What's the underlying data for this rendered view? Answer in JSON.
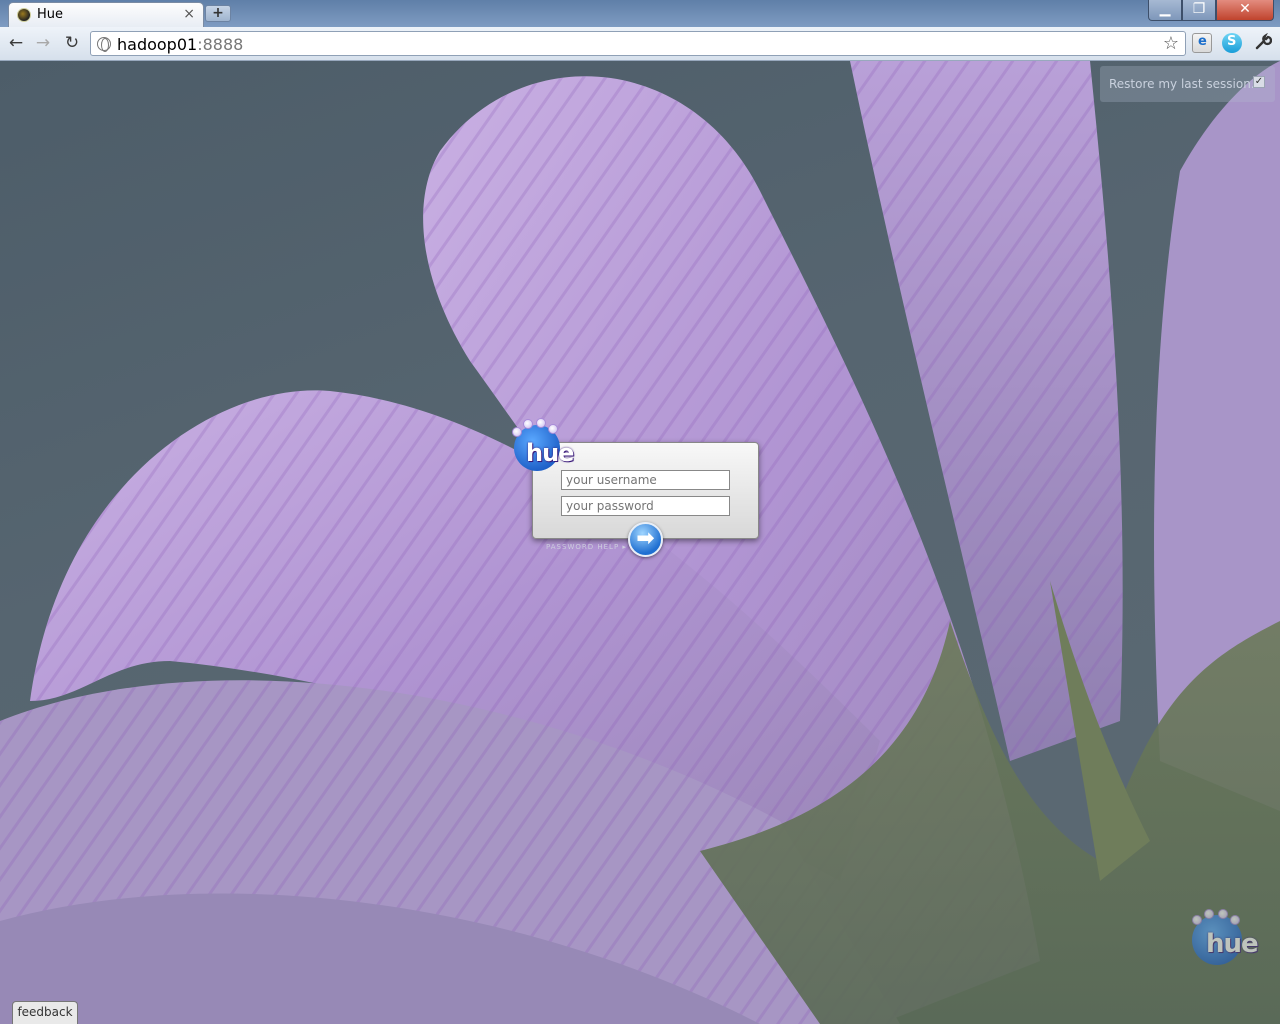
{
  "browser": {
    "tab": {
      "title": "Hue",
      "close_glyph": "×"
    },
    "new_tab_glyph": "+",
    "window_controls": {
      "minimize": "▁",
      "maximize": "❐",
      "close": "✕"
    },
    "nav": {
      "back": "←",
      "forward": "→",
      "reload": "↻"
    },
    "address": {
      "host": "hadoop01",
      "port": ":8888"
    },
    "bookmark_glyph": "☆",
    "wrench_glyph": "🔧"
  },
  "page": {
    "restore_session": {
      "label": "Restore my last session.",
      "checked": true,
      "check_glyph": "✓"
    },
    "login": {
      "logo_text": "hue",
      "username_placeholder": "your username",
      "password_placeholder": "your password",
      "password_help": "PASSWORD HELP ▸",
      "submit_glyph": "➡"
    },
    "corner_logo_text": "hue",
    "feedback_label": "feedback"
  },
  "colors": {
    "background": "#56656f",
    "petal": "#b59ad3",
    "accent_blue": "#1f6fd1"
  }
}
